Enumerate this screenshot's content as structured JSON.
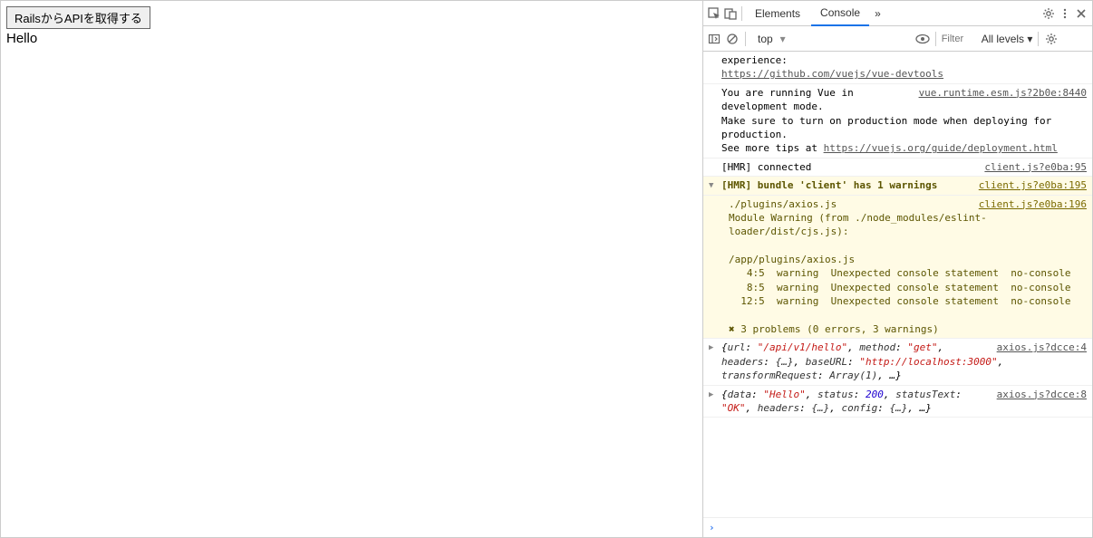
{
  "app": {
    "button_label": "RailsからAPIを取得する",
    "text": "Hello"
  },
  "devtools": {
    "tabs": {
      "elements": "Elements",
      "console": "Console",
      "more": "»"
    },
    "toolbar": {
      "context": "top",
      "filter_placeholder": "Filter",
      "levels": "All levels ▾"
    },
    "logs": {
      "vue_ext_tail": "experience:",
      "vue_ext_link": "https://github.com/vuejs/vue-devtools",
      "vue_dev_src": "vue.runtime.esm.js?2b0e:8440",
      "vue_dev_l1a": "You are running Vue in ",
      "vue_dev_l2": "development mode.",
      "vue_dev_l3": "Make sure to turn on production mode when deploying for production.",
      "vue_dev_l4a": "See more tips at ",
      "vue_dev_link": "https://vuejs.org/guide/deployment.html",
      "hmr_conn": "[HMR] connected",
      "hmr_conn_src": "client.js?e0ba:95",
      "hmr_warn_src": "client.js?e0ba:195",
      "hmr_warn": "[HMR] bundle 'client' has 1 warnings",
      "warn_src": "client.js?e0ba:196",
      "warn_l1": "./plugins/axios.js",
      "warn_l2": "Module Warning (from ./node_modules/eslint-loader/dist/cjs.js):",
      "warn_l3": "/app/plugins/axios.js",
      "warn_l4": "   4:5  warning  Unexpected console statement  no-console",
      "warn_l5": "   8:5  warning  Unexpected console statement  no-console",
      "warn_l6": "  12:5  warning  Unexpected console statement  no-console",
      "warn_l7": "✖ 3 problems (0 errors, 3 warnings)",
      "ax1_src": "axios.js?dcce:4",
      "ax1": {
        "url": "\"/api/v1/hello\"",
        "method": "\"get\"",
        "baseURL": "\"http://localhost:3000\""
      },
      "ax2_src": "axios.js?dcce:8",
      "ax2": {
        "data": "\"Hello\"",
        "status": "200",
        "statusText": "\"OK\""
      }
    }
  }
}
